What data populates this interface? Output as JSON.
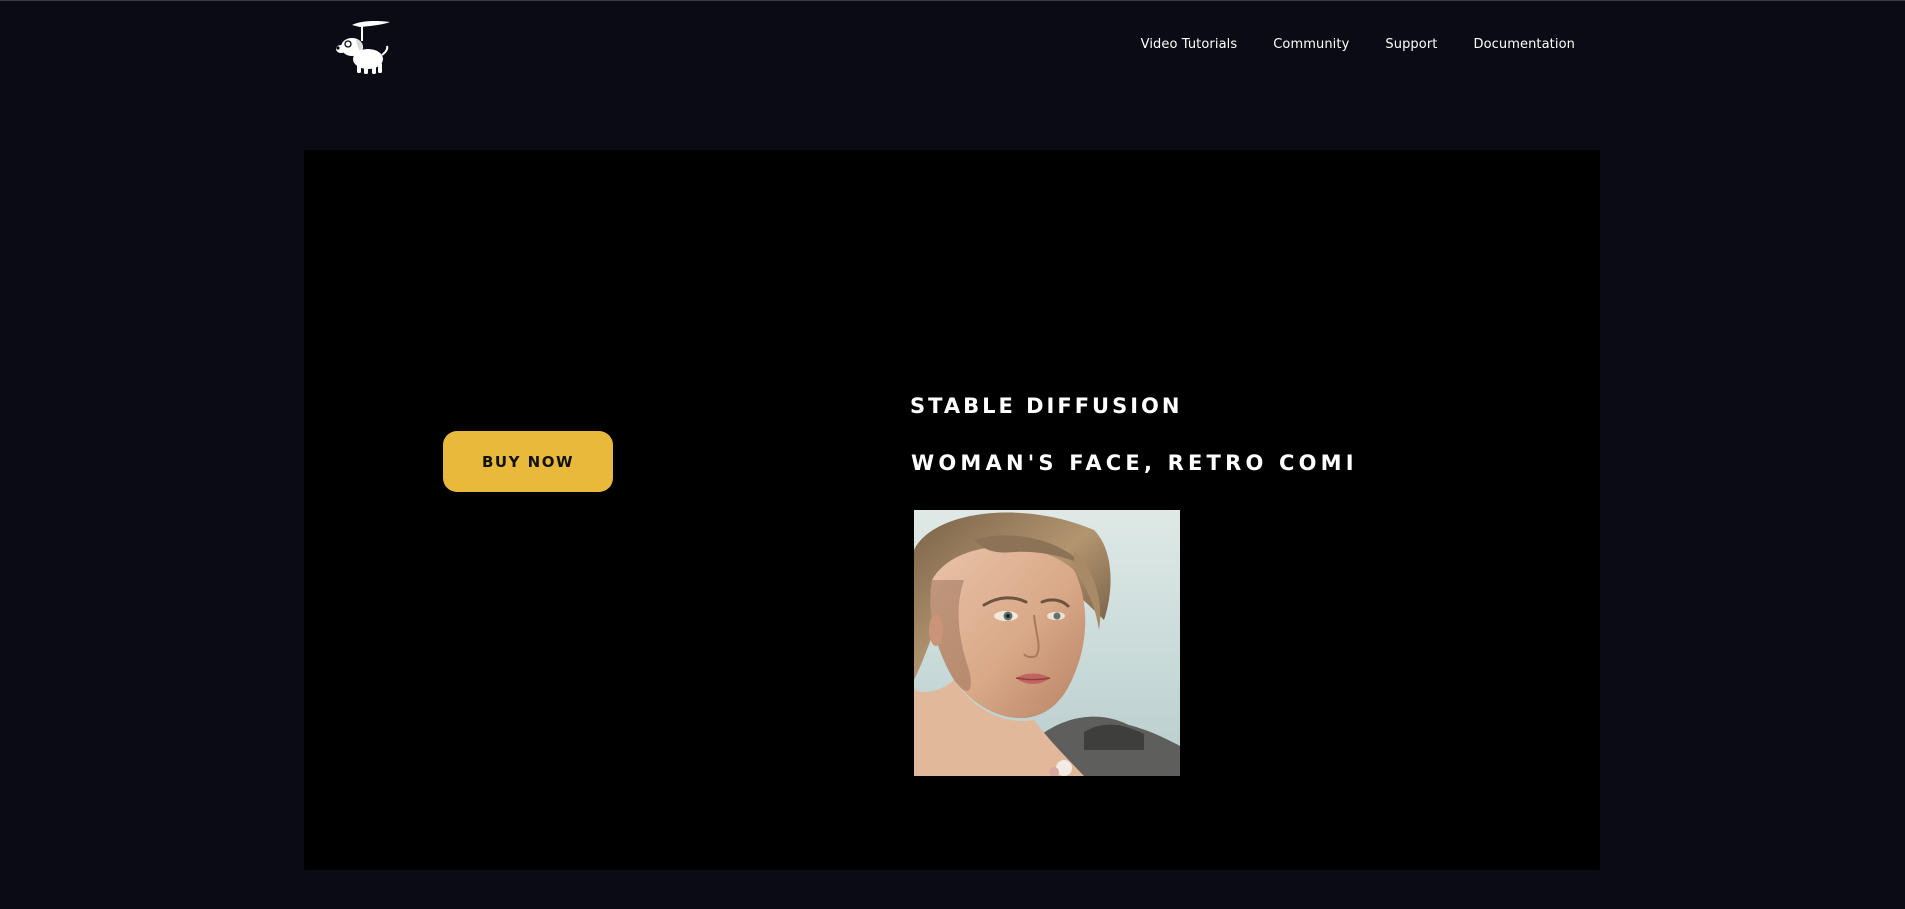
{
  "nav": {
    "logo_alt": "logo",
    "links": [
      {
        "label": "Video Tutorials"
      },
      {
        "label": "Community"
      },
      {
        "label": "Support"
      },
      {
        "label": "Documentation"
      }
    ]
  },
  "hero": {
    "buy_label": "BUY NOW",
    "headline_1": "STABLE DIFFUSION",
    "headline_2": "WOMAN'S FACE, RETRO COMI",
    "image_alt": "portrait of a woman"
  },
  "colors": {
    "page_bg": "#0a0b14",
    "hero_bg": "#000000",
    "accent": "#e8b93b",
    "text": "#ffffff"
  }
}
